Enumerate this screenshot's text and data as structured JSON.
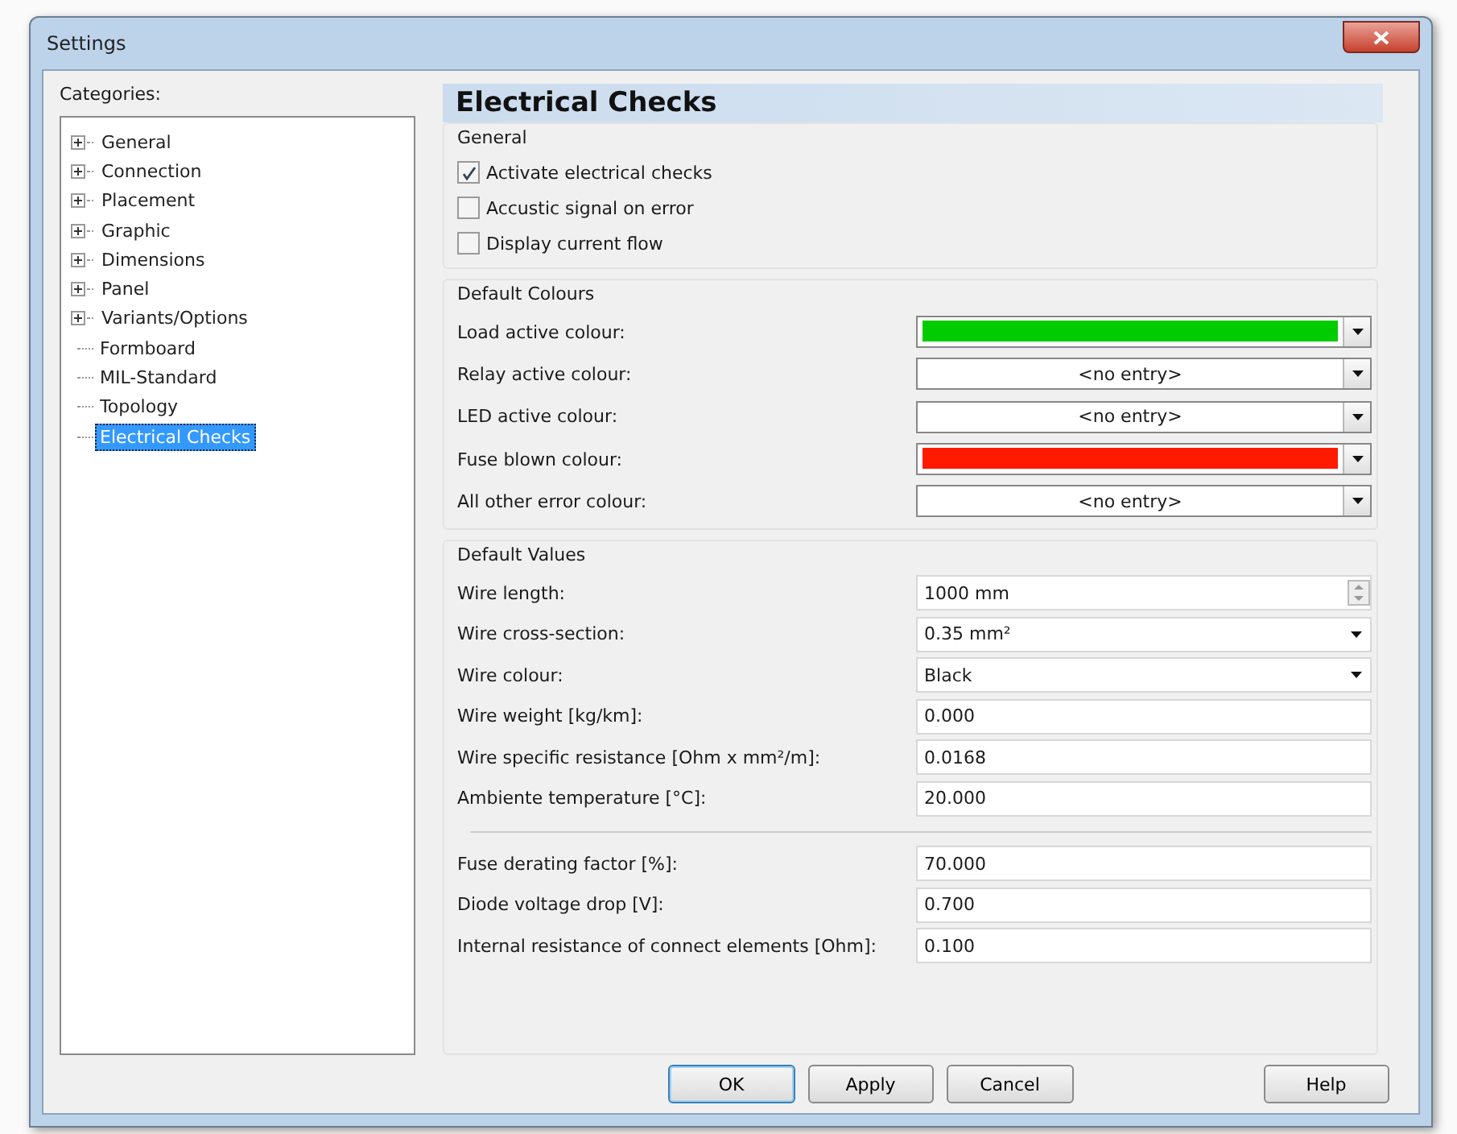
{
  "window": {
    "title": "Settings"
  },
  "categories": {
    "label": "Categories:",
    "items": [
      {
        "label": "General",
        "expandable": true,
        "selected": false
      },
      {
        "label": "Connection",
        "expandable": true,
        "selected": false
      },
      {
        "label": "Placement",
        "expandable": true,
        "selected": false
      },
      {
        "label": "Graphic",
        "expandable": true,
        "selected": false
      },
      {
        "label": "Dimensions",
        "expandable": true,
        "selected": false
      },
      {
        "label": "Panel",
        "expandable": true,
        "selected": false
      },
      {
        "label": "Variants/Options",
        "expandable": true,
        "selected": false
      },
      {
        "label": "Formboard",
        "expandable": false,
        "selected": false
      },
      {
        "label": "MIL-Standard",
        "expandable": false,
        "selected": false
      },
      {
        "label": "Topology",
        "expandable": false,
        "selected": false
      },
      {
        "label": "Electrical Checks",
        "expandable": false,
        "selected": true
      }
    ]
  },
  "page": {
    "title": "Electrical Checks",
    "general": {
      "title": "General",
      "options": [
        {
          "label": "Activate electrical checks",
          "checked": true
        },
        {
          "label": "Accustic signal on error",
          "checked": false
        },
        {
          "label": "Display current flow",
          "checked": false
        }
      ]
    },
    "colours": {
      "title": "Default Colours",
      "rows": [
        {
          "label": "Load active colour:",
          "kind": "swatch",
          "color": "#00cc00"
        },
        {
          "label": "Relay active colour:",
          "kind": "entry",
          "value": "<no entry>"
        },
        {
          "label": "LED active colour:",
          "kind": "entry",
          "value": "<no entry>"
        },
        {
          "label": "Fuse blown colour:",
          "kind": "swatch",
          "color": "#ff1a00"
        },
        {
          "label": "All other error colour:",
          "kind": "entry",
          "value": "<no entry>"
        }
      ]
    },
    "values": {
      "title": "Default Values",
      "rows": [
        {
          "label": "Wire length:",
          "kind": "spin",
          "value": "1000 mm"
        },
        {
          "label": "Wire cross-section:",
          "kind": "select",
          "value": "0.35 mm²"
        },
        {
          "label": "Wire colour:",
          "kind": "select",
          "value": "Black"
        },
        {
          "label": "Wire weight [kg/km]:",
          "kind": "text",
          "value": "0.000"
        },
        {
          "label": "Wire specific resistance [Ohm x mm²/m]:",
          "kind": "text",
          "value": "0.0168"
        },
        {
          "label": "Ambiente temperature [°C]:",
          "kind": "text",
          "value": "20.000"
        }
      ],
      "extra_rows": [
        {
          "label": "Fuse derating factor [%]:",
          "kind": "text",
          "value": "70.000"
        },
        {
          "label": "Diode voltage drop [V]:",
          "kind": "text",
          "value": "0.700"
        },
        {
          "label": "Internal resistance of connect elements [Ohm]:",
          "kind": "text",
          "value": "0.100"
        }
      ]
    }
  },
  "buttons": [
    {
      "label": "OK",
      "default": true
    },
    {
      "label": "Apply",
      "default": false
    },
    {
      "label": "Cancel",
      "default": false
    },
    {
      "label": "Help",
      "default": false
    }
  ]
}
